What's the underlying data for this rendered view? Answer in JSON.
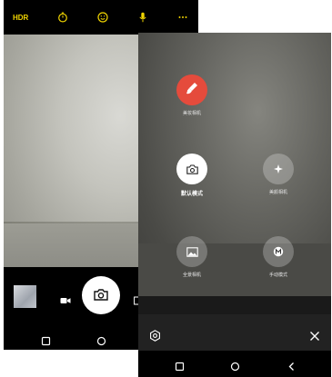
{
  "left_screen": {
    "top_bar": {
      "hdr_label": "HDR",
      "icons": [
        "timer-icon",
        "smile-icon",
        "microphone-icon",
        "more-icon"
      ],
      "accent_color": "#f0d400"
    },
    "bottom_controls": {
      "icons": [
        "gallery-thumbnail",
        "video-icon",
        "camera-shutter-icon"
      ]
    },
    "nav_icons": [
      "recent-apps-icon",
      "home-icon"
    ]
  },
  "right_screen": {
    "modes": [
      {
        "label": "美妆相机",
        "icon": "brush-icon",
        "selected": false,
        "color": "#e54b3c"
      },
      {
        "label": "默认模式",
        "icon": "camera-icon",
        "selected": true,
        "color": "#ffffff"
      },
      {
        "label": "美颜相机",
        "icon": "sparkle-icon",
        "selected": false,
        "color": "rgba(255,255,255,0.25)"
      },
      {
        "label": "全景相机",
        "icon": "image-icon",
        "selected": false,
        "color": "rgba(255,255,255,0.25)"
      },
      {
        "label": "手动模式",
        "icon": "manual-m-icon",
        "selected": false,
        "color": "rgba(255,255,255,0.25)"
      }
    ],
    "bottom_icons": [
      "settings-icon",
      "close-icon"
    ],
    "nav_icons": [
      "recent-apps-icon",
      "home-icon",
      "back-icon"
    ]
  }
}
